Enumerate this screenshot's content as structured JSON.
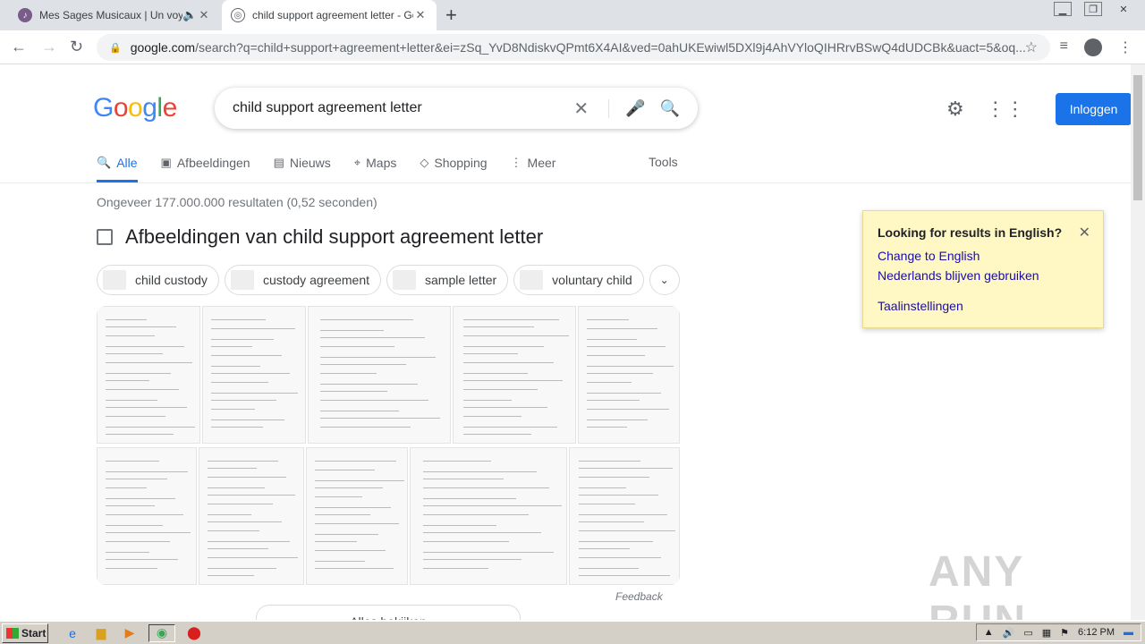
{
  "browser": {
    "tabs": [
      {
        "title": "Mes Sages Musicaux | Un voyag",
        "close": "✕"
      },
      {
        "title": "child support agreement letter - Goo",
        "close": "✕"
      }
    ],
    "new_tab": "+",
    "url_host": "google.com",
    "url_path": "/search?q=child+support+agreement+letter&ei=zSq_YvD8NdiskvQPmt6X4AI&ved=0ahUKEwiwl5DXl9j4AhVYloQIHRrvBSwQ4dUDCBk&uact=5&oq..."
  },
  "google": {
    "logo": [
      "G",
      "o",
      "o",
      "g",
      "l",
      "e"
    ],
    "logo_colors": [
      "#4285f4",
      "#ea4335",
      "#fbbc05",
      "#4285f4",
      "#34a853",
      "#ea4335"
    ],
    "query": "child support agreement letter",
    "login": "Inloggen",
    "tabs": [
      {
        "label": "Alle",
        "icon": "search-icon"
      },
      {
        "label": "Afbeeldingen",
        "icon": "image-icon"
      },
      {
        "label": "Nieuws",
        "icon": "news-icon"
      },
      {
        "label": "Maps",
        "icon": "map-pin-icon"
      },
      {
        "label": "Shopping",
        "icon": "tag-icon"
      },
      {
        "label": "Meer",
        "icon": "more-icon"
      }
    ],
    "tools": "Tools",
    "result_count": "Ongeveer 177.000.000 resultaten (0,52 seconden)",
    "images_heading": "Afbeeldingen van child support agreement letter",
    "chips": [
      "child custody",
      "custody agreement",
      "sample letter",
      "voluntary child"
    ],
    "feedback": "Feedback",
    "see_all": "Alles bekijken",
    "popup": {
      "heading": "Looking for results in English?",
      "link1": "Change to English",
      "link2": "Nederlands blijven gebruiken",
      "link3": "Taalinstellingen"
    }
  },
  "watermark": "ANY RUN",
  "taskbar": {
    "start": "Start",
    "time": "6:12 PM"
  }
}
